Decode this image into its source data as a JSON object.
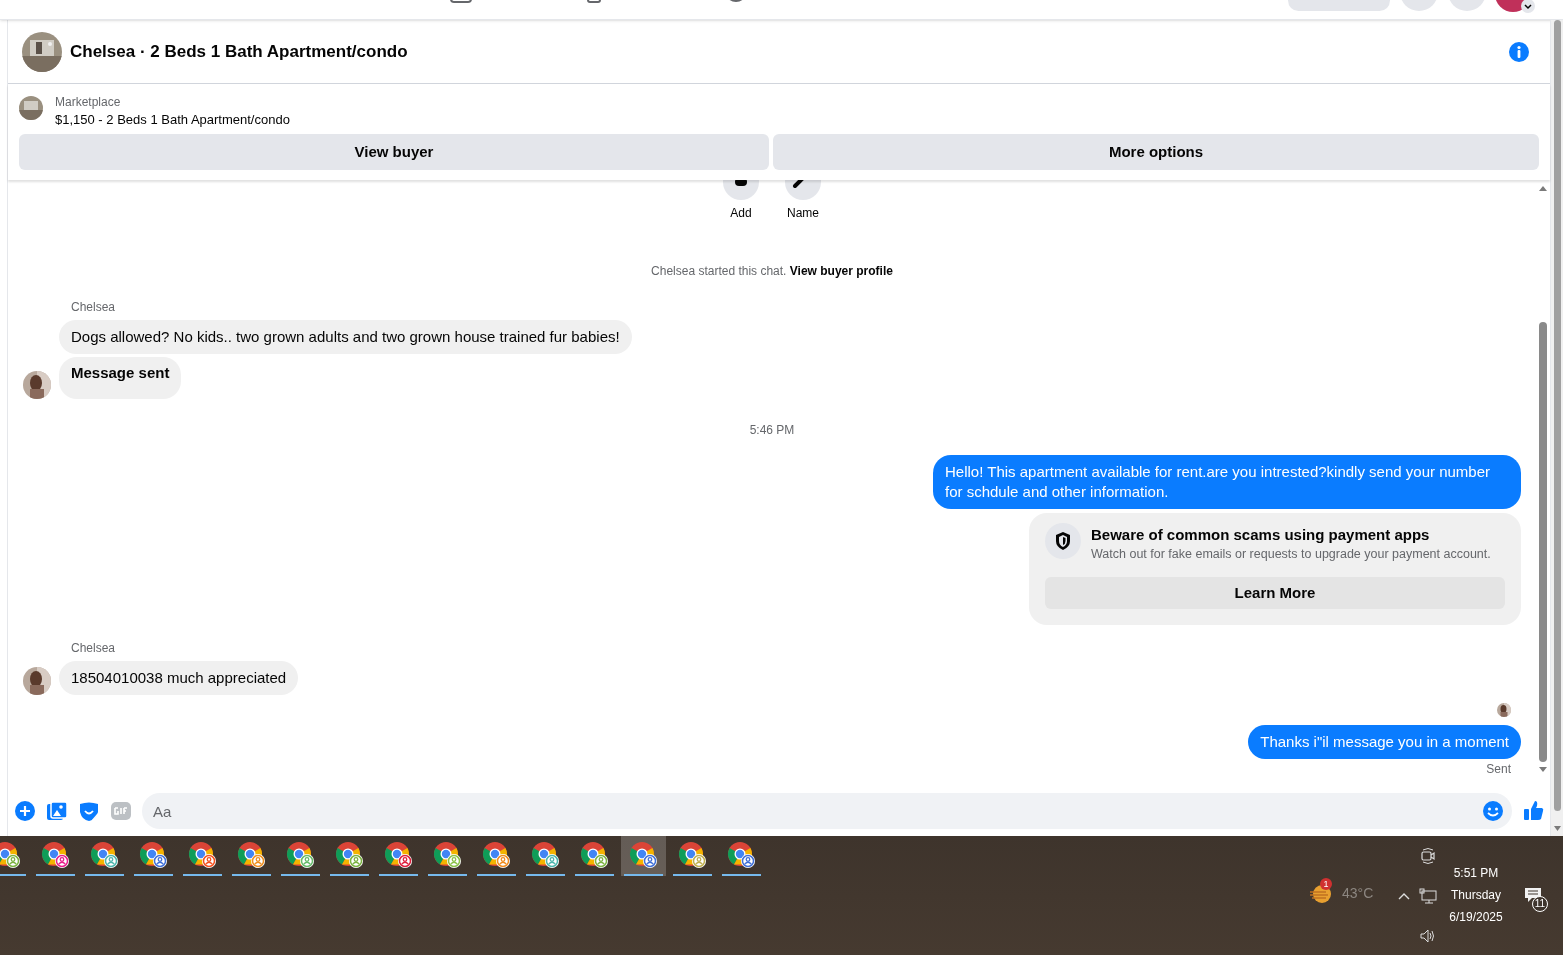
{
  "header": {
    "title": "Chelsea · 2 Beds 1 Bath Apartment/condo"
  },
  "listing": {
    "source": "Marketplace",
    "title": "$1,150 - 2 Beds 1 Bath Apartment/condo",
    "buttons": [
      "View buyer",
      "More options"
    ]
  },
  "actions": [
    "Add",
    "Name"
  ],
  "messages": [
    {
      "kind": "system",
      "text": "Chelsea started this chat.",
      "link": "View buyer profile"
    },
    {
      "kind": "sender",
      "text": "Chelsea"
    },
    {
      "kind": "incoming",
      "text": "Dogs allowed? No kids.. two grown adults and two grown house trained fur babies!",
      "avatar": false,
      "bold": false
    },
    {
      "kind": "incoming",
      "text": "Message sent",
      "avatar": true,
      "bold": true
    },
    {
      "kind": "time",
      "text": "5:46 PM"
    },
    {
      "kind": "outgoing",
      "text": "Hello! This apartment available for rent.are you intrested?kindly send your number for schdule and other information."
    },
    {
      "kind": "card",
      "title": "Beware of common scams using payment apps",
      "text": "Watch out for fake emails or requests to upgrade your payment account.",
      "button": "Learn More"
    },
    {
      "kind": "sender",
      "text": "Chelsea"
    },
    {
      "kind": "incoming",
      "text": "18504010038 much appreciated",
      "avatar": true,
      "bold": false
    },
    {
      "kind": "seen"
    },
    {
      "kind": "outgoing",
      "text": "Thanks i\"il message you in a moment"
    },
    {
      "kind": "status",
      "text": "Sent"
    }
  ],
  "composer": {
    "placeholder": "Aa"
  },
  "taskbar": {
    "apps": [
      {
        "color": "#7cb342",
        "selected": false
      },
      {
        "color": "#e91e8c",
        "selected": false
      },
      {
        "color": "#4db6ac",
        "selected": false
      },
      {
        "color": "#3f6fd8",
        "selected": false
      },
      {
        "color": "#f4511e",
        "selected": false
      },
      {
        "color": "#f09020",
        "selected": false
      },
      {
        "color": "#66bb6a",
        "selected": false
      },
      {
        "color": "#7cb342",
        "selected": false
      },
      {
        "color": "#e0203c",
        "selected": false
      },
      {
        "color": "#8bc34a",
        "selected": false
      },
      {
        "color": "#f08c1e",
        "selected": false
      },
      {
        "color": "#4db6ac",
        "selected": false
      },
      {
        "color": "#7cb342",
        "selected": false
      },
      {
        "color": "#3f6fd8",
        "selected": true
      },
      {
        "color": "#c0b050",
        "selected": false
      },
      {
        "color": "#3f6fd8",
        "selected": false
      }
    ],
    "weather_badge": "1",
    "temperature": "43°C",
    "time": "5:51 PM",
    "day": "Thursday",
    "date": "6/19/2025",
    "notifications": "11"
  }
}
